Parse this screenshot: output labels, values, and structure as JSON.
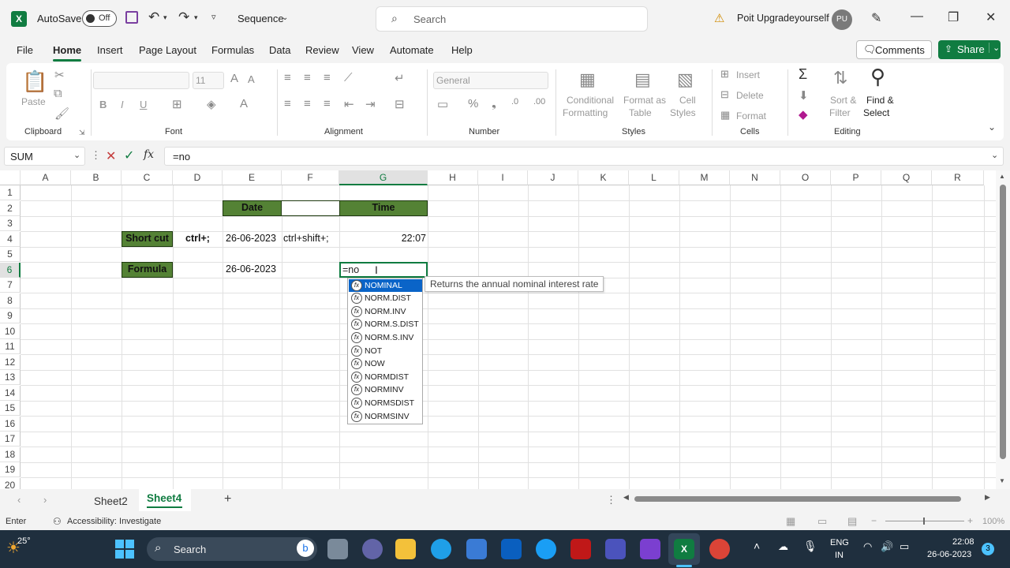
{
  "titlebar": {
    "autosave_label": "AutoSave",
    "toggle_state": "Off",
    "doc_title": "Sequence",
    "search_placeholder": "Search",
    "user_name": "Poit Upgradeyourself",
    "user_initials": "PU"
  },
  "menu": {
    "tabs": [
      "File",
      "Home",
      "Insert",
      "Page Layout",
      "Formulas",
      "Data",
      "Review",
      "View",
      "Automate",
      "Help"
    ],
    "active": "Home",
    "comments_label": "Comments",
    "share_label": "Share"
  },
  "ribbon": {
    "clipboard": {
      "label": "Clipboard",
      "paste": "Paste"
    },
    "font": {
      "label": "Font",
      "font_name": "",
      "font_size": "11",
      "bold": "B",
      "italic": "I",
      "underline": "U"
    },
    "alignment": {
      "label": "Alignment"
    },
    "number": {
      "label": "Number",
      "format": "General"
    },
    "styles": {
      "label": "Styles",
      "conditional": [
        "Conditional",
        "Formatting"
      ],
      "format_as": [
        "Format as",
        "Table"
      ],
      "cell_styles": [
        "Cell",
        "Styles"
      ]
    },
    "cells": {
      "label": "Cells",
      "insert": "Insert",
      "delete": "Delete",
      "format": "Format"
    },
    "editing": {
      "label": "Editing",
      "sort_filter": [
        "Sort &",
        "Filter"
      ],
      "find_select": [
        "Find &",
        "Select"
      ]
    }
  },
  "formula_bar": {
    "name_box": "SUM",
    "fx": "fx",
    "formula": "=no"
  },
  "grid": {
    "columns": [
      "A",
      "B",
      "C",
      "D",
      "E",
      "F",
      "G",
      "H",
      "I",
      "J",
      "K",
      "L",
      "M",
      "N",
      "O",
      "P",
      "Q",
      "R"
    ],
    "rows": [
      "1",
      "2",
      "3",
      "4",
      "5",
      "6",
      "7",
      "8",
      "9",
      "10",
      "11",
      "12",
      "13",
      "14",
      "15",
      "16",
      "17",
      "18",
      "19",
      "20"
    ],
    "selected_column": "G",
    "selected_row": "6",
    "cells": {
      "E2": "Date",
      "G2": "Time",
      "C4": "Short cut",
      "D4": "ctrl+;",
      "E4": "26-06-2023",
      "F4": "ctrl+shift+;",
      "G4": "22:07",
      "C6": "Formula",
      "E6": "26-06-2023",
      "G6": "=no"
    }
  },
  "autocomplete": {
    "items": [
      "NOMINAL",
      "NORM.DIST",
      "NORM.INV",
      "NORM.S.DIST",
      "NORM.S.INV",
      "NOT",
      "NOW",
      "NORMDIST",
      "NORMINV",
      "NORMSDIST",
      "NORMSINV"
    ],
    "selected_index": 0,
    "tooltip": "Returns the annual nominal interest rate"
  },
  "sheets": {
    "tabs": [
      "Sheet2",
      "Sheet4"
    ],
    "active": "Sheet4",
    "add": "+"
  },
  "status": {
    "mode": "Enter",
    "accessibility": "Accessibility: Investigate",
    "zoom": "100%"
  },
  "taskbar": {
    "weather": "25°",
    "search_label": "Search",
    "lang": "ENG",
    "lang_region": "IN",
    "time": "22:08",
    "date": "26-06-2023",
    "notifications": "3"
  },
  "colors": {
    "accent": "#107c41",
    "header_fill": "#548235",
    "selection_blue": "#0a64c8"
  }
}
